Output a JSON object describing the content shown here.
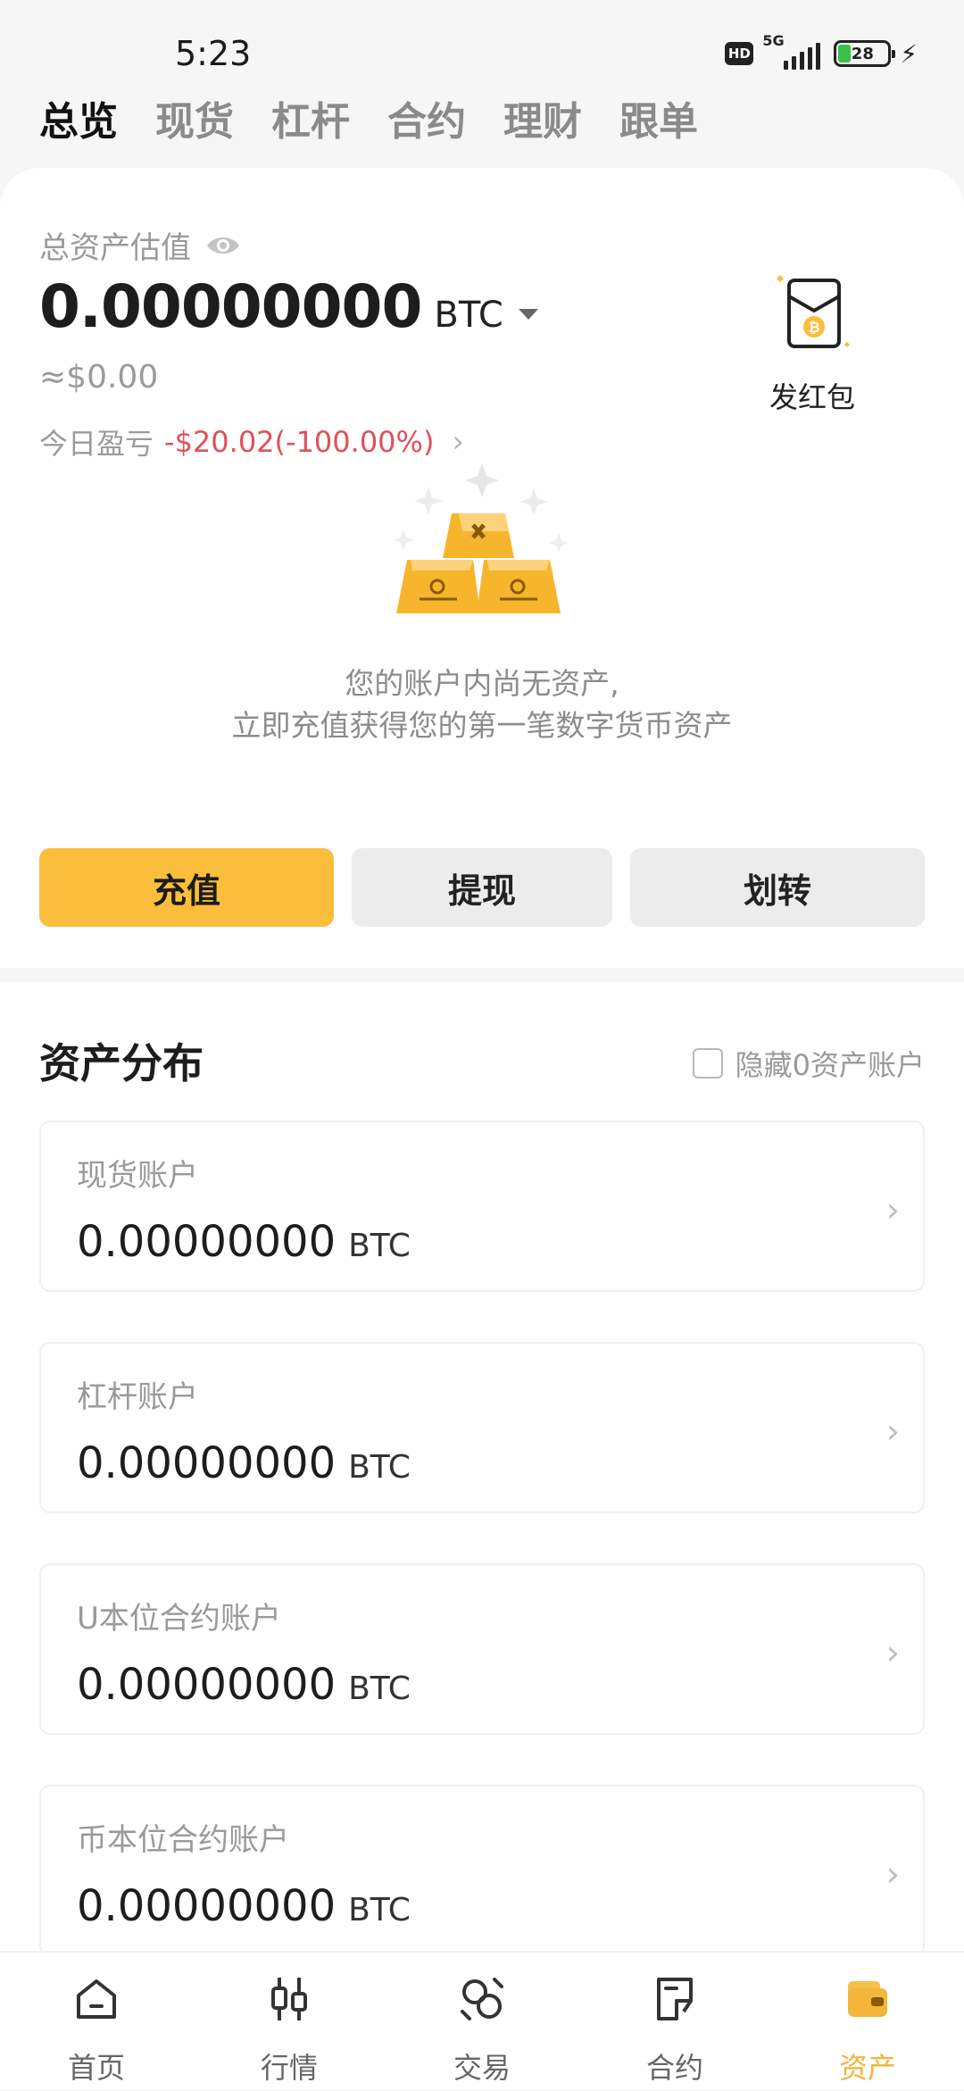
{
  "status_bar": {
    "time": "5:23",
    "hd": "HD",
    "network": "5G",
    "battery": "28"
  },
  "top_tabs": [
    {
      "label": "总览",
      "active": true
    },
    {
      "label": "现货",
      "active": false
    },
    {
      "label": "杠杆",
      "active": false
    },
    {
      "label": "合约",
      "active": false
    },
    {
      "label": "理财",
      "active": false
    },
    {
      "label": "跟单",
      "active": false
    }
  ],
  "overview": {
    "total_label": "总资产估值",
    "amount": "0.00000000",
    "unit": "BTC",
    "usd": "≈$0.00",
    "pnl_label": "今日盈亏",
    "pnl_value": "-$20.02(-100.00%)",
    "red_packet_label": "发红包"
  },
  "empty_state": {
    "line1": "您的账户内尚无资产,",
    "line2": "立即充值获得您的第一笔数字货币资产"
  },
  "actions": {
    "deposit": "充值",
    "withdraw": "提现",
    "transfer": "划转"
  },
  "distribution": {
    "title": "资产分布",
    "hide_zero_label": "隐藏0资产账户",
    "accounts": [
      {
        "name": "现货账户",
        "value": "0.00000000",
        "unit": "BTC"
      },
      {
        "name": "杠杆账户",
        "value": "0.00000000",
        "unit": "BTC"
      },
      {
        "name": "U本位合约账户",
        "value": "0.00000000",
        "unit": "BTC"
      },
      {
        "name": "币本位合约账户",
        "value": "0.00000000",
        "unit": "BTC"
      }
    ]
  },
  "bottom_nav": [
    {
      "label": "首页",
      "icon": "home-icon"
    },
    {
      "label": "行情",
      "icon": "candlestick-icon"
    },
    {
      "label": "交易",
      "icon": "exchange-icon"
    },
    {
      "label": "合约",
      "icon": "contract-icon"
    },
    {
      "label": "资产",
      "icon": "wallet-icon",
      "active": true
    }
  ],
  "colors": {
    "accent": "#fbbd3c",
    "negative": "#e0505a",
    "active_nav": "#f3b53a"
  }
}
